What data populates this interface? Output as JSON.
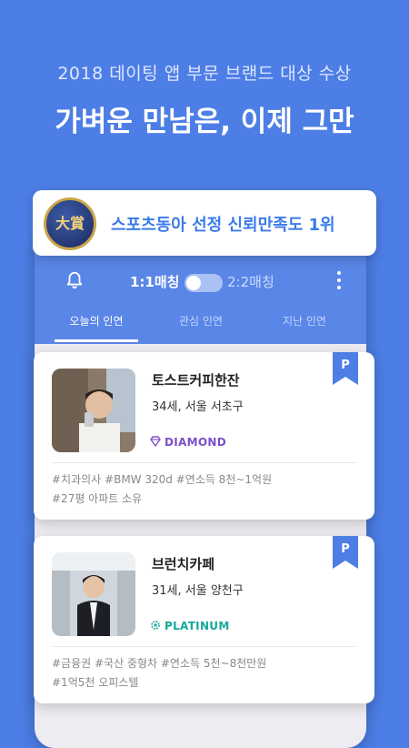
{
  "hero": {
    "subtitle": "2018 데이팅 앱 부문 브랜드 대상 수상",
    "title": "가벼운 만남은, 이제 그만"
  },
  "award": {
    "medal_label": "大賞",
    "text": "스포츠동아 선정 신뢰만족도 1위"
  },
  "app": {
    "match_left": "1:1매칭",
    "match_right": "2:2매칭",
    "toggle_on": false,
    "tabs": [
      "오늘의 인연",
      "관심 인연",
      "지난 인연"
    ],
    "active_tab": 0
  },
  "cards": [
    {
      "name": "토스트커피한잔",
      "meta": "34세, 서울 서초구",
      "tier": "DIAMOND",
      "tier_color": "#7b4fc9",
      "tier_icon": "diamond-icon",
      "badge": "P",
      "tags_line1": "#치과의사 #BMW 320d #연소득 8천~1억원",
      "tags_line2": "#27평 아파트 소유"
    },
    {
      "name": "브런치카페",
      "meta": "31세, 서울 양천구",
      "tier": "PLATINUM",
      "tier_color": "#16a89a",
      "tier_icon": "gear-badge-icon",
      "badge": "P",
      "tags_line1": "#금융권 #국산 중형차 #연소득 5천~8천만원",
      "tags_line2": "#1억5천 오피스텔"
    }
  ],
  "colors": {
    "background": "#4d7ee6",
    "app_header": "#5a86e8",
    "accent": "#3b7be9",
    "flag": "#4d7ee6"
  }
}
